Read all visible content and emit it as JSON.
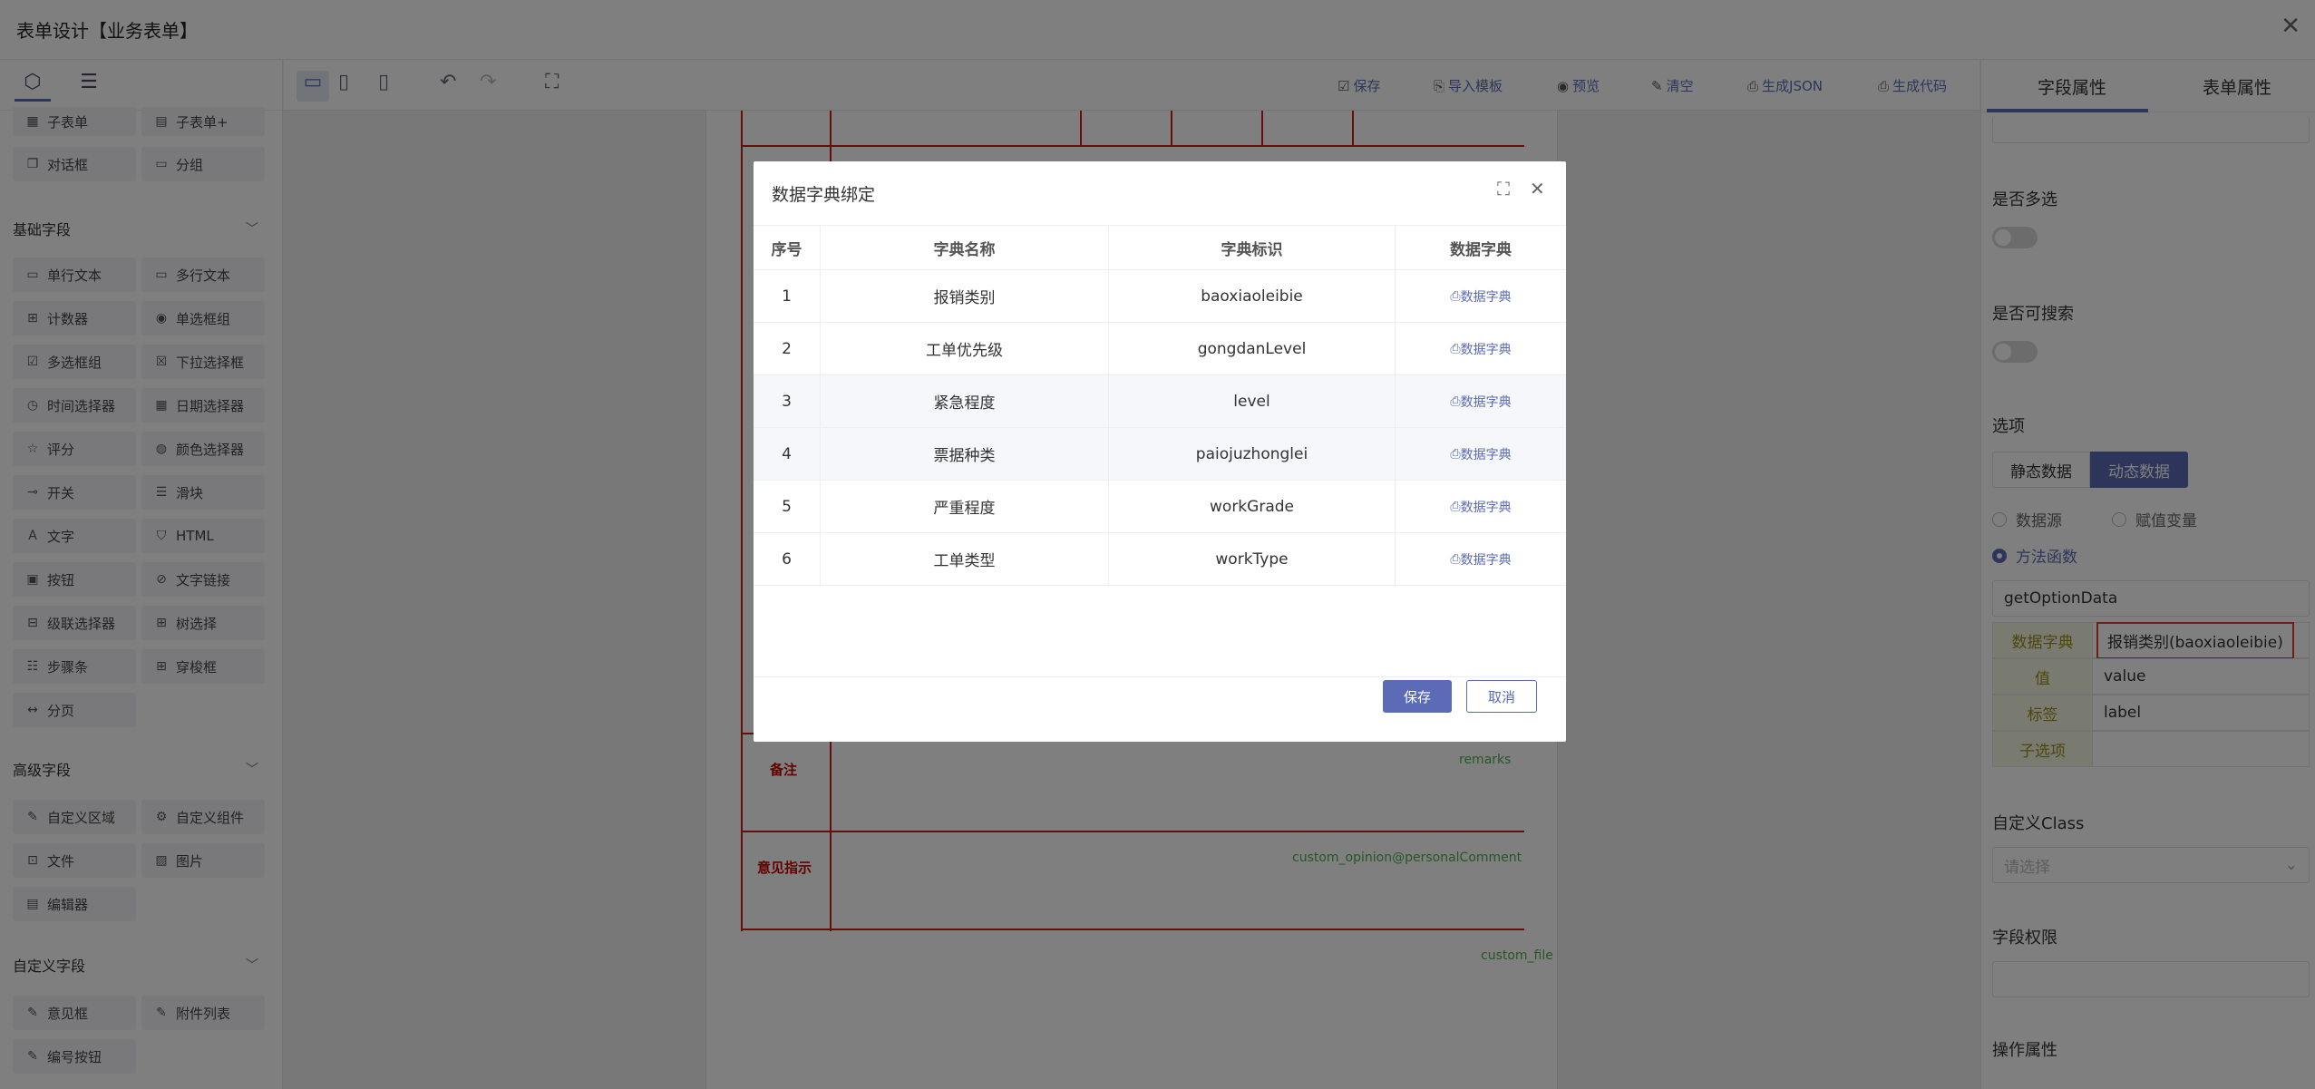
{
  "window": {
    "title": "表单设计【业务表单】",
    "close": "✕"
  },
  "left_sections": {
    "top_items": [
      "子表单",
      "子表单+",
      "对话框",
      "分组"
    ],
    "basic": {
      "title": "基础字段",
      "items": [
        "单行文本",
        "多行文本",
        "计数器",
        "单选框组",
        "多选框组",
        "下拉选择框",
        "时间选择器",
        "日期选择器",
        "评分",
        "颜色选择器",
        "开关",
        "滑块",
        "文字",
        "HTML",
        "按钮",
        "文字链接",
        "级联选择器",
        "树选择",
        "步骤条",
        "穿梭框",
        "分页"
      ]
    },
    "advanced": {
      "title": "高级字段",
      "items": [
        "自定义区域",
        "自定义组件",
        "文件",
        "图片",
        "编辑器"
      ]
    },
    "custom": {
      "title": "自定义字段",
      "items": [
        "意见框",
        "附件列表",
        "编号按钮"
      ]
    }
  },
  "toolbar": {
    "actions": [
      "保存",
      "导入模板",
      "预览",
      "清空",
      "生成JSON",
      "生成代码"
    ]
  },
  "canvas": {
    "label_remark": "备注",
    "label_opinion": "意见指示",
    "field_remarks": "remarks",
    "field_opinion": "custom_opinion@personalComment",
    "field_file": "custom_file"
  },
  "right_panel": {
    "tabs": [
      "字段属性",
      "表单属性"
    ],
    "multi_label": "是否多选",
    "search_label": "是否可搜索",
    "options_label": "选项",
    "seg": [
      "静态数据",
      "动态数据"
    ],
    "radios": [
      "数据源",
      "赋值变量",
      "方法函数"
    ],
    "method_value": "getOptionData",
    "kv": [
      {
        "k": "数据字典",
        "v": "报销类别(baoxiaoleibie)"
      },
      {
        "k": "值",
        "v": "value"
      },
      {
        "k": "标签",
        "v": "label"
      },
      {
        "k": "子选项",
        "v": ""
      }
    ],
    "class_label": "自定义Class",
    "class_placeholder": "请选择",
    "perm_label": "字段权限",
    "ops_label": "操作属性"
  },
  "dialog": {
    "title": "数据字典绑定",
    "headers": [
      "序号",
      "字典名称",
      "字典标识",
      "数据字典"
    ],
    "rows": [
      {
        "no": "1",
        "name": "报销类别",
        "code": "baoxiaoleibie",
        "link": "数据字典"
      },
      {
        "no": "2",
        "name": "工单优先级",
        "code": "gongdanLevel",
        "link": "数据字典"
      },
      {
        "no": "3",
        "name": "紧急程度",
        "code": "level",
        "link": "数据字典"
      },
      {
        "no": "4",
        "name": "票据种类",
        "code": "paiojuzhonglei",
        "link": "数据字典"
      },
      {
        "no": "5",
        "name": "严重程度",
        "code": "workGrade",
        "link": "数据字典"
      },
      {
        "no": "6",
        "name": "工单类型",
        "code": "workType",
        "link": "数据字典"
      }
    ],
    "save": "保存",
    "cancel": "取消"
  },
  "colors": {
    "accent": "#5b6bb5",
    "red_line": "#d01818"
  }
}
